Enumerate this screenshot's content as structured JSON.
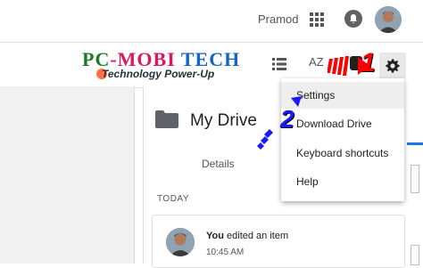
{
  "header": {
    "user_name": "Pramod"
  },
  "logo": {
    "title_part1": "PC",
    "title_part2": "-MOBI",
    "title_part3": " TECH",
    "tagline": "Technology Power-Up"
  },
  "toolbar": {
    "sort_label": "AZ"
  },
  "main": {
    "title": "My Drive",
    "details_tab": "Details",
    "section_label": "TODAY",
    "activity": {
      "user": "You",
      "action": " edited an item",
      "time": "10:45 AM"
    }
  },
  "settings_menu": {
    "items": [
      {
        "label": "Settings"
      },
      {
        "label": "Download Drive"
      },
      {
        "label": "Keyboard shortcuts"
      },
      {
        "label": "Help"
      }
    ]
  },
  "annotations": {
    "step1": "1",
    "step2": "2"
  },
  "colors": {
    "accent_blue": "#1a73e8",
    "annotation_red": "#ff0000",
    "annotation_blue": "#1a1aff"
  }
}
